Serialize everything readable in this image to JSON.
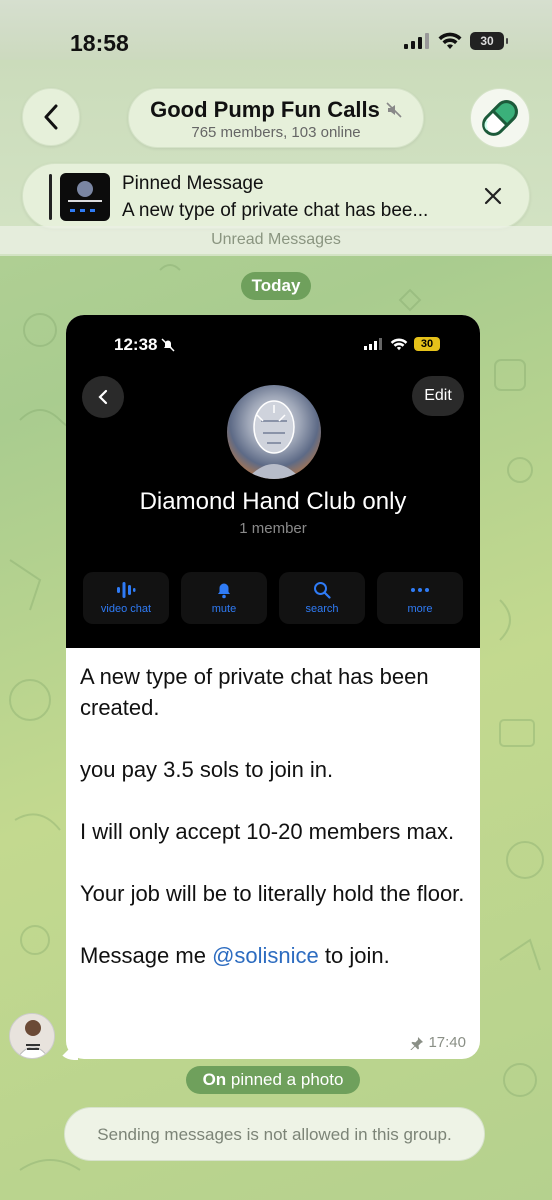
{
  "status_bar": {
    "time": "18:58",
    "battery": "30"
  },
  "header": {
    "title": "Good Pump Fun Calls",
    "subtitle": "765 members, 103 online"
  },
  "pinned": {
    "title": "Pinned Message",
    "preview": "A new type of private chat has bee..."
  },
  "unread_label": "Unread Messages",
  "date_label": "Today",
  "message": {
    "screenshot": {
      "time": "12:38",
      "battery": "30",
      "edit_label": "Edit",
      "group_name": "Diamond Hand Club only",
      "members": "1 member",
      "actions": [
        {
          "label": "video chat",
          "icon": "voice-chat-icon"
        },
        {
          "label": "mute",
          "icon": "bell-icon"
        },
        {
          "label": "search",
          "icon": "search-icon"
        },
        {
          "label": "more",
          "icon": "more-icon"
        }
      ]
    },
    "paragraphs": [
      "A new type of private chat has been created.",
      "you pay 3.5 sols to join in.",
      "I will only accept 10-20 members max.",
      "Your job will be to literally hold the floor."
    ],
    "last_prefix": "Message me ",
    "mention": "@solisnice",
    "last_suffix": " to join.",
    "time": "17:40"
  },
  "service": {
    "actor": "On",
    "action": " pinned a photo"
  },
  "footer": "Sending messages is not allowed in this group.",
  "colors": {
    "accent_green": "#6fa05c",
    "mention_blue": "#2d6cc0",
    "action_blue": "#2f7bf5"
  }
}
